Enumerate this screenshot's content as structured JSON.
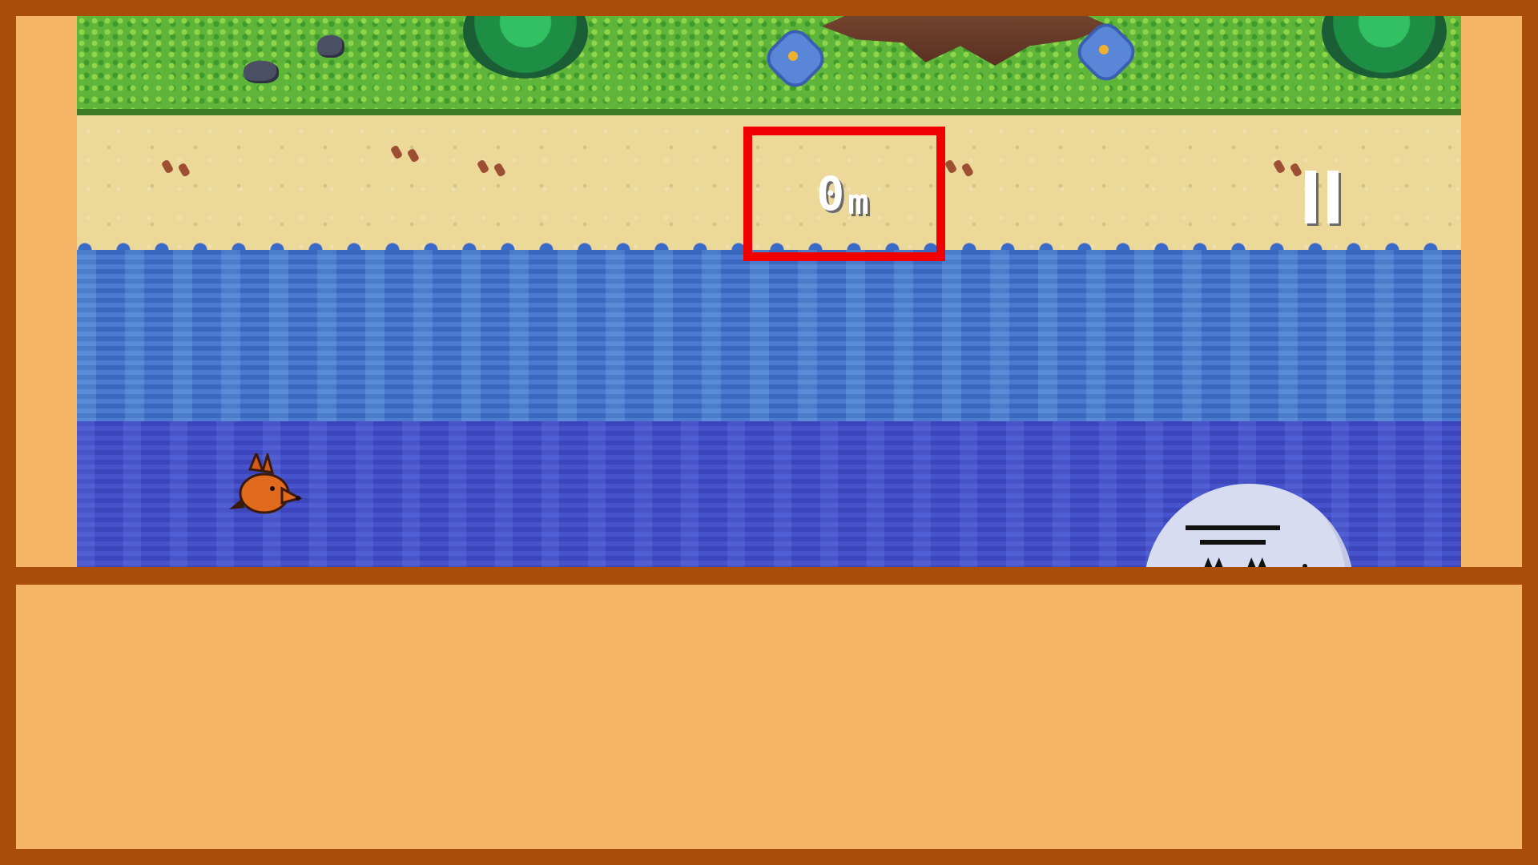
{
  "hud": {
    "distance_value": "0",
    "distance_unit": "m",
    "pause_icon": "pause-icon"
  },
  "colors": {
    "frame": "#A94E0A",
    "panel": "#F6B566",
    "highlight": "#F00000",
    "hud_text": "#FFFFFF"
  }
}
